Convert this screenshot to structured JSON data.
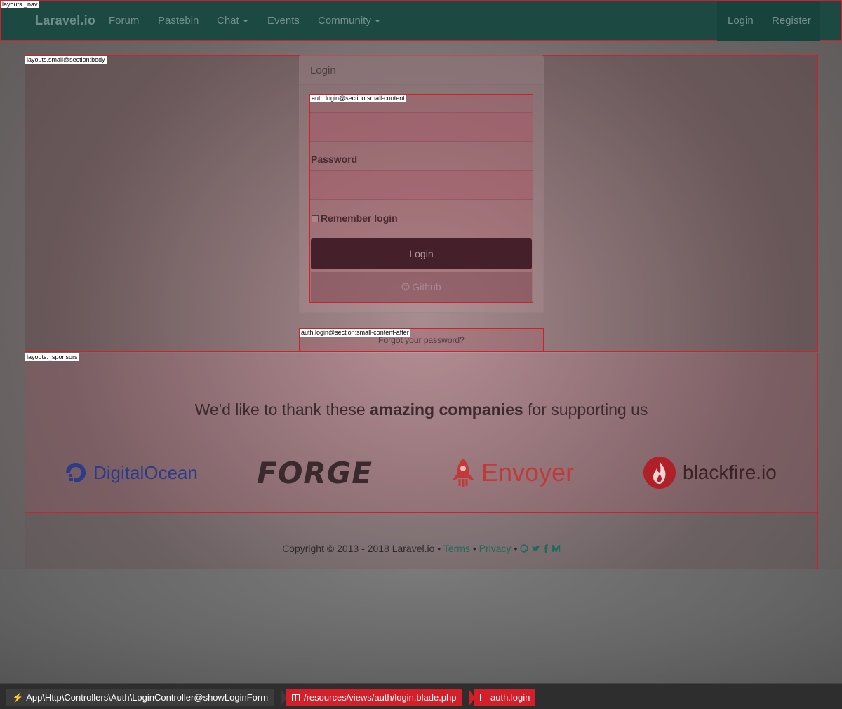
{
  "debug_labels": {
    "nav": "layouts._nav",
    "body": "layouts.small@section:body",
    "small_content": "auth.login@section:small-content",
    "small_content_after": "auth.login@section:small-content-after",
    "sponsors": "layouts._sponsors"
  },
  "nav": {
    "brand": "Laravel.io",
    "links": [
      "Forum",
      "Pastebin",
      "Chat",
      "Events",
      "Community"
    ],
    "login": "Login",
    "register": "Register"
  },
  "login_panel": {
    "title": "Login",
    "password_label": "Password",
    "remember_label": "Remember login",
    "login_button": "Login",
    "github_button": "Github",
    "forgot_link": "Forgot your password?"
  },
  "sponsors": {
    "thanks_pre": "We'd like to thank these ",
    "thanks_bold": "amazing companies",
    "thanks_post": " for supporting us",
    "logos": [
      "DigitalOcean",
      "FORGE",
      "Envoyer",
      "blackfire.io"
    ]
  },
  "footer": {
    "copyright": "Copyright © 2013 - 2018 Laravel.io",
    "separator": "•",
    "terms": "Terms",
    "privacy": "Privacy"
  },
  "debugbar": {
    "controller": "App\\Http\\Controllers\\Auth\\LoginController@showLoginForm",
    "view_path": "/resources/views/auth/login.blade.php",
    "view_name": "auth.login"
  },
  "colors": {
    "nav_bg": "#1c4a43",
    "login_button": "#45202b",
    "debug_red": "#d31f2a",
    "digitalocean": "#2a3c8a",
    "forge": "#3a2a2e",
    "envoyer": "#c03a3a",
    "blackfire": "#b02028"
  }
}
